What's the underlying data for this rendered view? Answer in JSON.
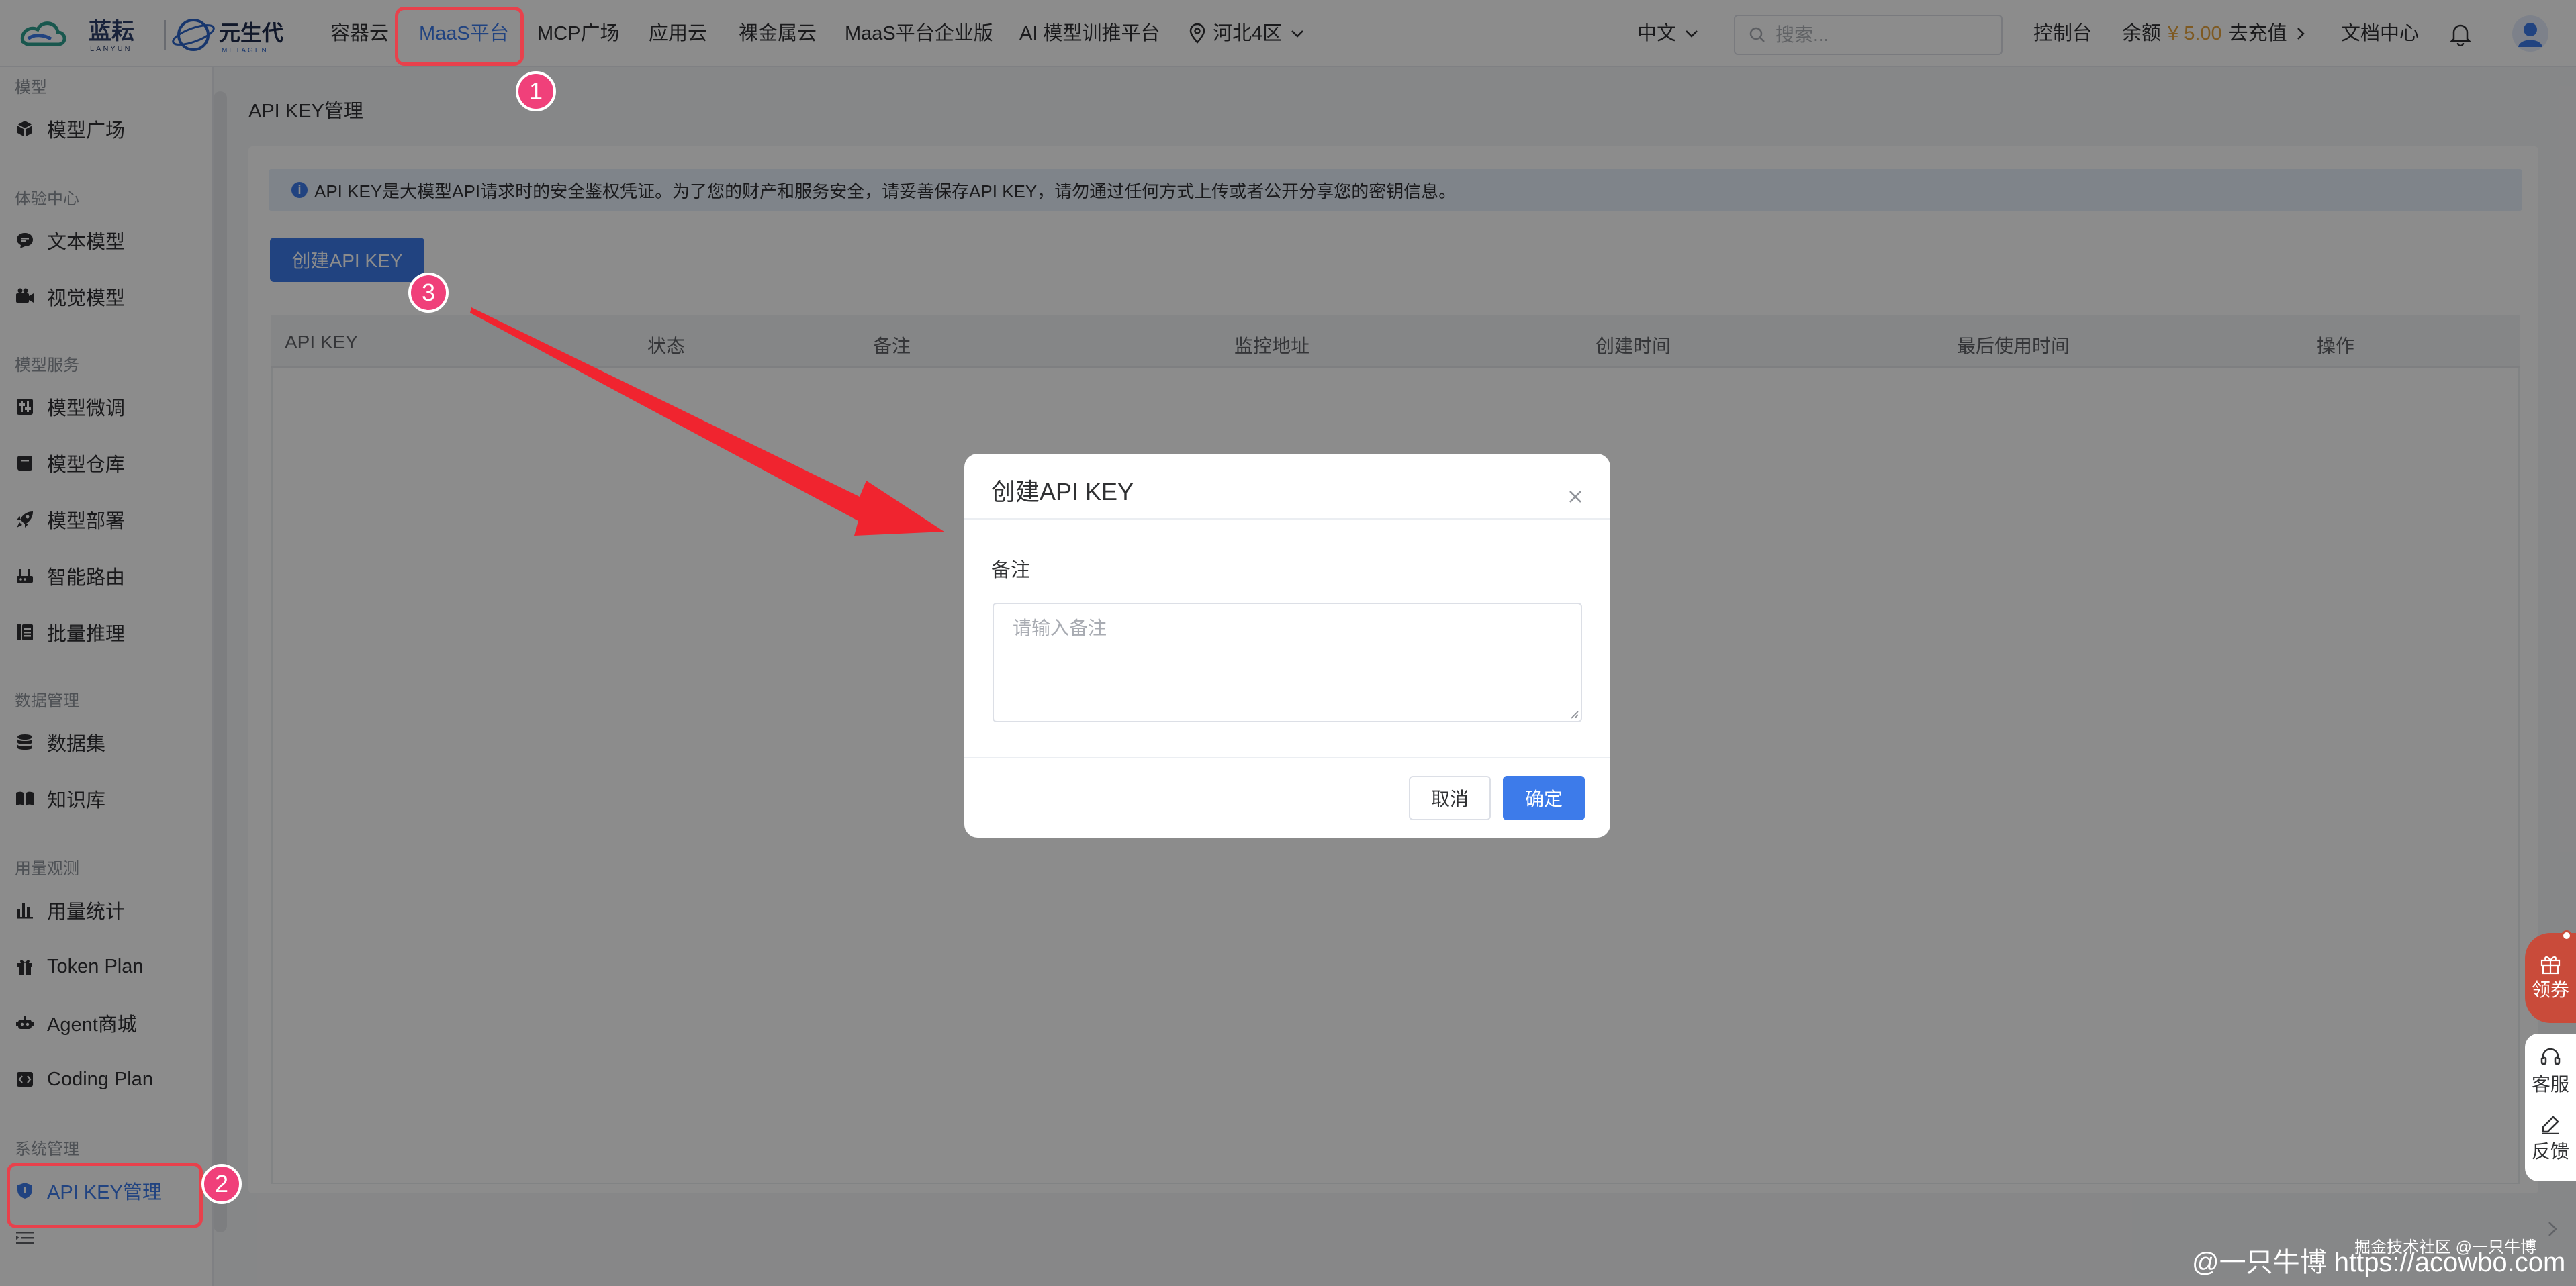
{
  "brand": {
    "name_cn": "蓝耘",
    "name_en": "LANYUN",
    "partner_cn": "元生代",
    "partner_en": "METAGEN"
  },
  "topnav": {
    "items": [
      "容器云",
      "MaaS平台",
      "MCP广场",
      "应用云",
      "裸金属云",
      "MaaS平台企业版",
      "AI 模型训推平台"
    ],
    "active": "MaaS平台",
    "region": "河北4区",
    "language": "中文",
    "search_placeholder": "搜索...",
    "console": "控制台",
    "balance_label": "余额",
    "balance_amount": "¥ 5.00",
    "recharge": "去充值",
    "docs": "文档中心"
  },
  "sidebar": {
    "groups": [
      {
        "title": "模型",
        "items": [
          {
            "label": "模型广场",
            "icon": "cube-icon"
          }
        ]
      },
      {
        "title": "体验中心",
        "items": [
          {
            "label": "文本模型",
            "icon": "chat-icon"
          },
          {
            "label": "视觉模型",
            "icon": "camera-icon"
          }
        ]
      },
      {
        "title": "模型服务",
        "items": [
          {
            "label": "模型微调",
            "icon": "tune-icon"
          },
          {
            "label": "模型仓库",
            "icon": "archive-icon"
          },
          {
            "label": "模型部署",
            "icon": "rocket-icon"
          },
          {
            "label": "智能路由",
            "icon": "router-icon"
          },
          {
            "label": "批量推理",
            "icon": "list-icon"
          }
        ]
      },
      {
        "title": "数据管理",
        "items": [
          {
            "label": "数据集",
            "icon": "database-icon"
          },
          {
            "label": "知识库",
            "icon": "book-icon"
          }
        ]
      },
      {
        "title": "用量观测",
        "items": [
          {
            "label": "用量统计",
            "icon": "bar-chart-icon"
          },
          {
            "label": "Token Plan",
            "icon": "gift-icon"
          },
          {
            "label": "Agent商城",
            "icon": "robot-icon"
          },
          {
            "label": "Coding Plan",
            "icon": "code-icon"
          }
        ]
      },
      {
        "title": "系统管理",
        "items": [
          {
            "label": "API KEY管理",
            "icon": "shield-icon",
            "active": true
          }
        ]
      }
    ]
  },
  "page": {
    "title": "API KEY管理",
    "info": "API KEY是大模型API请求时的安全鉴权凭证。为了您的财产和服务安全，请妥善保存API KEY，请勿通过任何方式上传或者公开分享您的密钥信息。",
    "create_button": "创建API KEY",
    "columns": [
      "API KEY",
      "状态",
      "备注",
      "监控地址",
      "创建时间",
      "最后使用时间",
      "操作"
    ]
  },
  "dialog": {
    "title": "创建API KEY",
    "field_label": "备注",
    "placeholder": "请输入备注",
    "value": "",
    "cancel": "取消",
    "confirm": "确定"
  },
  "annotations": {
    "badges": [
      "1",
      "2",
      "3"
    ],
    "color": "#e8414c",
    "badge_color": "#f0407a"
  },
  "float": {
    "coupon": "领券",
    "service": "客服",
    "feedback": "反馈"
  },
  "watermark": {
    "line1": "掘金技术社区 @一只牛博",
    "line2": "@一只牛博 https://acowbo.com"
  },
  "colors": {
    "primary": "#3d7bea",
    "balance": "#e6a23c"
  }
}
